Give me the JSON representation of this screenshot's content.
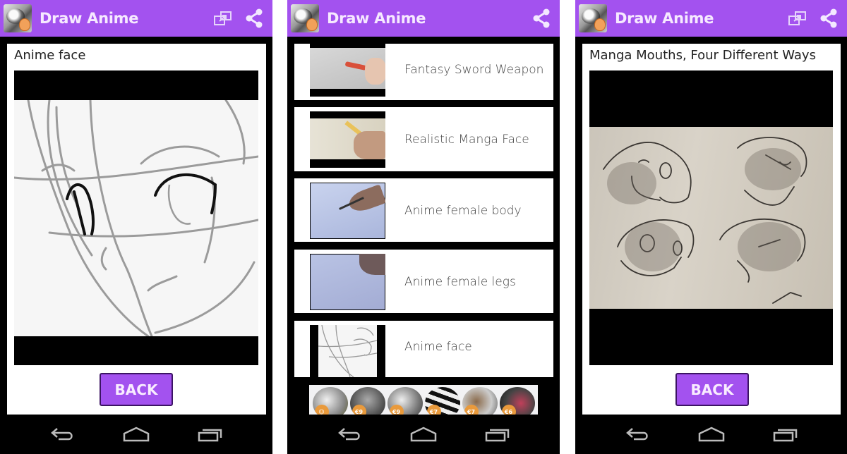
{
  "app": {
    "title": "Draw Anime",
    "accent_color": "#a352ef",
    "icons": {
      "app_icon": "anime-girl-logo-icon",
      "open_external": "open-in-new-window-icon",
      "share": "share-icon"
    }
  },
  "screens": [
    {
      "name": "detail-anime-face",
      "title": "Anime face",
      "video_thumbnail": "anime-face-sketch",
      "back_label": "BACK",
      "toolbar_icons": [
        "open-in-new-window-icon",
        "share-icon"
      ]
    },
    {
      "name": "tutorial-list",
      "toolbar_icons": [
        "share-icon"
      ],
      "items": [
        {
          "label": "Fantasy Sword Weapon",
          "thumbnail": "hand-with-red-pen"
        },
        {
          "label": "Realistic Manga Face",
          "thumbnail": "hand-with-pencil"
        },
        {
          "label": "Anime female body",
          "thumbnail": "pen-drawing-body"
        },
        {
          "label": "Anime female legs",
          "thumbnail": "pen-drawing-legs"
        },
        {
          "label": "Anime face",
          "thumbnail": "anime-face-sketch"
        }
      ],
      "ad_banner": {
        "items": [
          {
            "price": ""
          },
          {
            "price": "€9"
          },
          {
            "price": "€9"
          },
          {
            "price": "€7"
          },
          {
            "price": "€7"
          },
          {
            "price": "€6"
          }
        ]
      }
    },
    {
      "name": "detail-manga-mouths",
      "title": "Manga Mouths, Four Different Ways",
      "video_thumbnail": "four-manga-heads-sketch",
      "back_label": "BACK",
      "toolbar_icons": [
        "open-in-new-window-icon",
        "share-icon"
      ]
    }
  ],
  "navigation_bar": {
    "buttons": [
      "back-icon",
      "home-icon",
      "recent-apps-icon"
    ]
  }
}
